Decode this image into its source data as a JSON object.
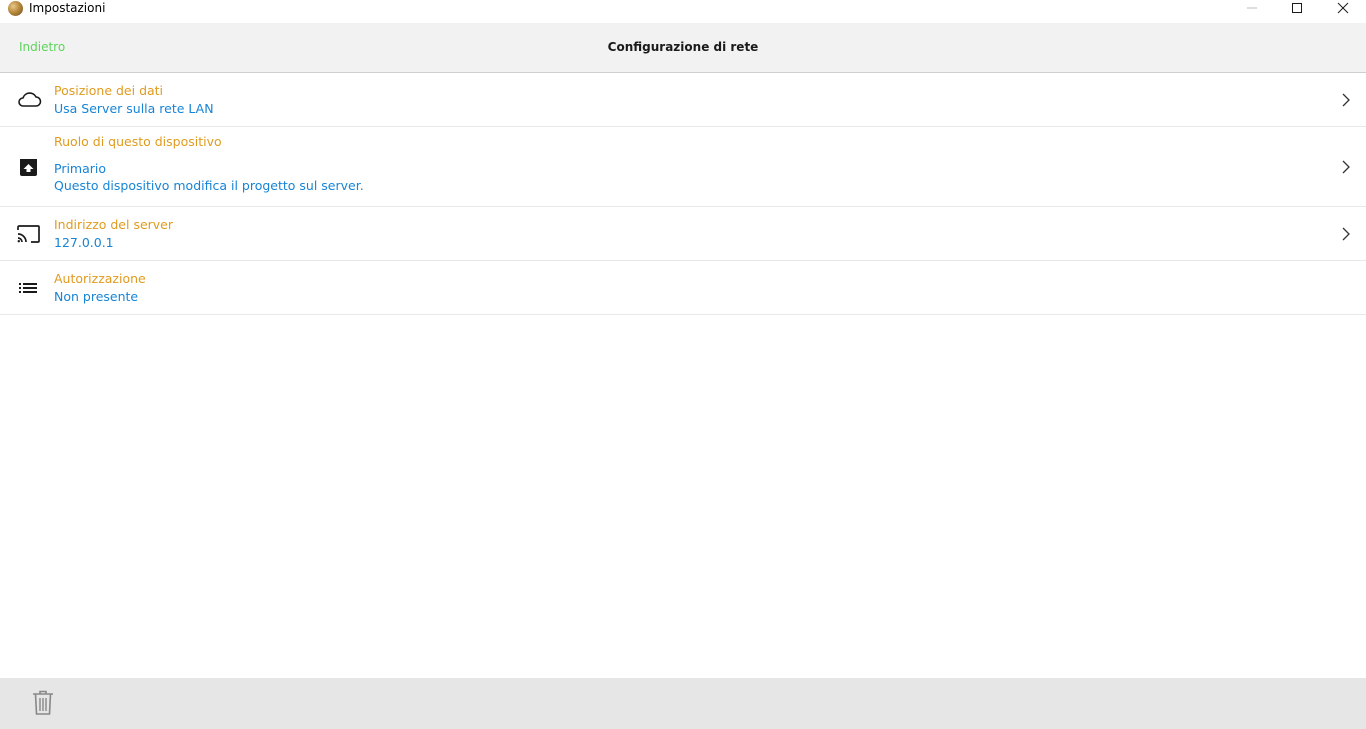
{
  "window": {
    "title": "Impostazioni",
    "icon": "app-globe-icon"
  },
  "header": {
    "back_label": "Indietro",
    "title": "Configurazione di rete"
  },
  "colors": {
    "accent_back": "#5ed35e",
    "row_title": "#e09b1f",
    "row_value": "#1784d6",
    "header_bg": "#f2f2f2",
    "footer_bg": "#e6e6e6"
  },
  "settings": [
    {
      "icon": "cloud-icon",
      "title": "Posizione dei dati",
      "value": "Usa Server sulla rete LAN",
      "has_chevron": true
    },
    {
      "icon": "upload-box-icon",
      "title": "Ruolo di questo dispositivo",
      "value": "Primario",
      "description": "Questo dispositivo modifica il progetto sul server.",
      "has_chevron": true
    },
    {
      "icon": "cast-icon",
      "title": "Indirizzo del server",
      "value": "127.0.0.1",
      "has_chevron": true
    },
    {
      "icon": "list-icon",
      "title": "Autorizzazione",
      "value": "Non presente",
      "has_chevron": false
    }
  ],
  "footer": {
    "delete_icon": "trash-icon"
  }
}
